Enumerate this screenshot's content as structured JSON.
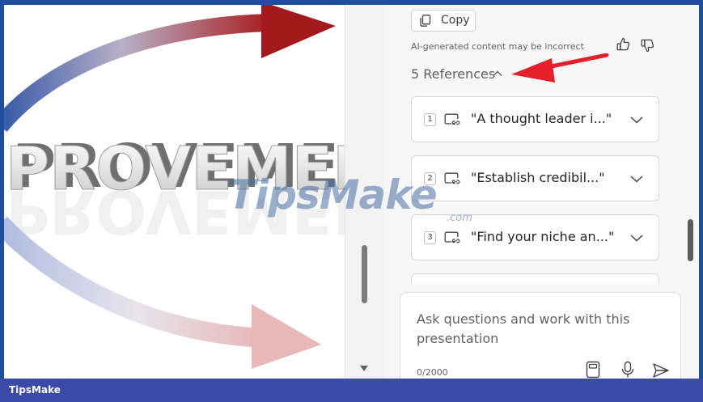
{
  "slide": {
    "image_text": "PROVEMENT"
  },
  "pane": {
    "copy_label": "Copy",
    "disclaimer": "AI-generated content may be incorrect",
    "references_header": "5 References",
    "references": [
      {
        "number": "1",
        "text": "\"A thought leader i...\""
      },
      {
        "number": "2",
        "text": "\"Establish credibil...\""
      },
      {
        "number": "3",
        "text": "\"Find your niche an...\""
      }
    ]
  },
  "chat": {
    "placeholder": "Ask questions and work with this presentation",
    "char_count": "0/2000"
  },
  "icons": {
    "copy": "copy-icon",
    "thumbs_up": "thumbs-up-icon",
    "thumbs_down": "thumbs-down-icon",
    "reference": "slide-link-icon",
    "attach": "notebook-icon",
    "mic": "microphone-icon",
    "send": "send-icon"
  },
  "watermark": {
    "main": "TipsMake",
    "suffix": ".com"
  },
  "footer": {
    "label": "TipsMake"
  },
  "colors": {
    "frame": "#1f4e9c",
    "footer": "#3b4aa8",
    "annotation_arrow": "#e5202a"
  }
}
